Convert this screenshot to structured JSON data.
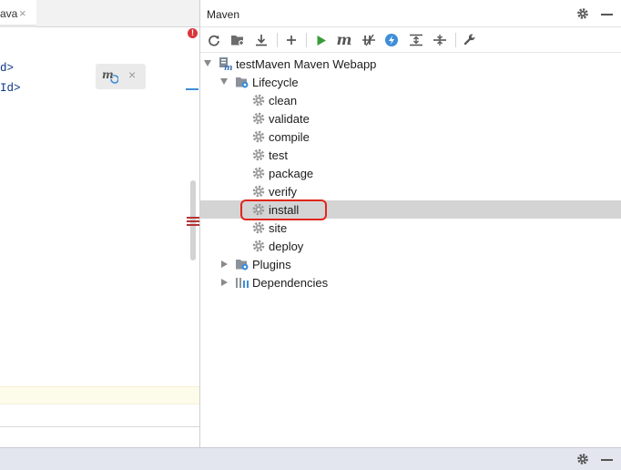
{
  "editor": {
    "tab_label": "ava",
    "tab_close": "×",
    "error_mark": "!",
    "code_lines": [
      "d>",
      "Id>"
    ],
    "popup_close": "×"
  },
  "maven": {
    "title": "Maven",
    "toolbar": [
      "reload-icon",
      "add-folder-icon",
      "download-icon",
      "plus-icon",
      "run-icon",
      "maven-goal-icon",
      "skip-tests-icon",
      "offline-icon",
      "expand-all-icon",
      "collapse-all-icon",
      "wrench-icon"
    ],
    "project": "testMaven Maven Webapp",
    "lifecycle": {
      "label": "Lifecycle",
      "items": [
        "clean",
        "validate",
        "compile",
        "test",
        "package",
        "verify",
        "install",
        "site",
        "deploy"
      ],
      "selected": "install"
    },
    "plugins": "Plugins",
    "dependencies": "Dependencies"
  },
  "colors": {
    "accent": "#3d8ed8",
    "run": "#3a9b3a",
    "highlight_box": "#e0261b",
    "selection": "#d4d4d4"
  }
}
